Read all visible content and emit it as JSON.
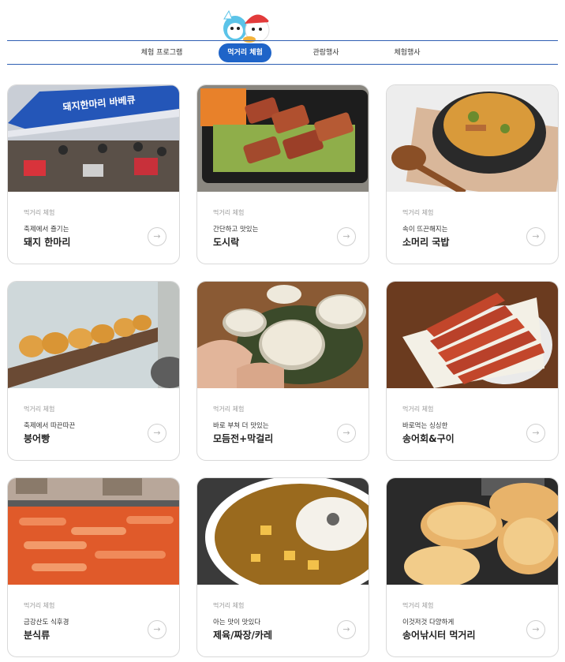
{
  "tabs": [
    {
      "label": "체험 프로그램",
      "active": false
    },
    {
      "label": "먹거리 체험",
      "active": true
    },
    {
      "label": "관람행사",
      "active": false
    },
    {
      "label": "체험행사",
      "active": false
    }
  ],
  "colors": {
    "accent": "#1f64c8",
    "rule": "#2f5fb3"
  },
  "cards": [
    {
      "category": "먹거리 체험",
      "subtitle": "축제에서 즐기는",
      "title": "돼지 한마리",
      "banner": "돼지한마리 바베큐",
      "arrow": "→",
      "icon": "arrow-right-icon"
    },
    {
      "category": "먹거리 체험",
      "subtitle": "간단하고 맛있는",
      "title": "도시락",
      "arrow": "→",
      "icon": "arrow-right-icon"
    },
    {
      "category": "먹거리 체험",
      "subtitle": "속이 뜨끈해지는",
      "title": "소머리 국밥",
      "arrow": "→",
      "icon": "arrow-right-icon"
    },
    {
      "category": "먹거리 체험",
      "subtitle": "축제에서 따끈따끈",
      "title": "붕어빵",
      "arrow": "→",
      "icon": "arrow-right-icon"
    },
    {
      "category": "먹거리 체험",
      "subtitle": "바로 부쳐 더 맛있는",
      "title": "모듬전+막걸리",
      "arrow": "→",
      "icon": "arrow-right-icon"
    },
    {
      "category": "먹거리 체험",
      "subtitle": "바로먹는 싱싱한",
      "title": "송어회&구이",
      "arrow": "→",
      "icon": "arrow-right-icon"
    },
    {
      "category": "먹거리 체험",
      "subtitle": "금강산도 식후경",
      "title": "분식류",
      "arrow": "→",
      "icon": "arrow-right-icon"
    },
    {
      "category": "먹거리 체험",
      "subtitle": "아는 맛이 맛있다",
      "title": "제육/짜장/카레",
      "arrow": "→",
      "icon": "arrow-right-icon"
    },
    {
      "category": "먹거리 체험",
      "subtitle": "이것저것 다양하게",
      "title": "송어낚시터 먹거리",
      "arrow": "→",
      "icon": "arrow-right-icon"
    }
  ]
}
